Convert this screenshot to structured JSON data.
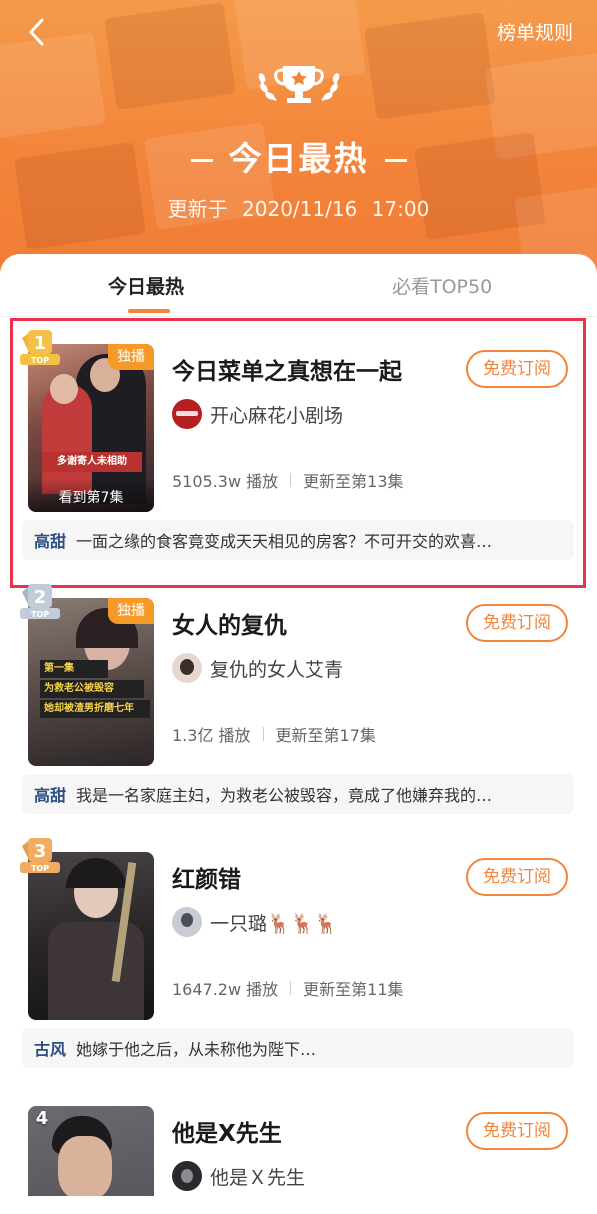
{
  "header": {
    "rules_label": "榜单规则",
    "title": "今日最热",
    "updated_prefix": "更新于",
    "updated_date": "2020/11/16",
    "updated_time": "17:00"
  },
  "tabs": [
    {
      "label": "今日最热",
      "active": true
    },
    {
      "label": "必看TOP50",
      "active": false
    }
  ],
  "colors": {
    "accent": "#f3843a",
    "highlight": "#e8334a",
    "genre": "#2b4f83",
    "exclusive": "#f59a28"
  },
  "items": [
    {
      "rank": "1",
      "rank_label": "TOP",
      "title": "今日菜单之真想在一起",
      "exclusive": "独播",
      "watch_progress": "看到第7集",
      "poster_text": "多谢寄人未相助",
      "author": "开心麻花小剧场",
      "plays": "5105.3w 播放",
      "updated": "更新至第13集",
      "genre": "高甜",
      "description": "一面之缘的食客竟变成天天相见的房客？不可开交的欢喜…",
      "subscribe": "免费订阅"
    },
    {
      "rank": "2",
      "rank_label": "TOP",
      "title": "女人的复仇",
      "exclusive": "独播",
      "poster_text_1": "第一集",
      "poster_text_2": "为救老公被毁容",
      "poster_text_3": "她却被渣男折磨七年",
      "author": "复仇的女人艾青",
      "plays": "1.3亿 播放",
      "updated": "更新至第17集",
      "genre": "高甜",
      "description": "我是一名家庭主妇，为救老公被毁容，竟成了他嫌弃我的…",
      "subscribe": "免费订阅"
    },
    {
      "rank": "3",
      "rank_label": "TOP",
      "title": "红颜错",
      "author": "一只璐🦌🦌🦌",
      "plays": "1647.2w 播放",
      "updated": "更新至第11集",
      "genre": "古风",
      "description": "她嫁于他之后，从未称他为陛下…",
      "subscribe": "免费订阅"
    },
    {
      "rank": "4",
      "title": "他是X先生",
      "author": "他是Ｘ先生",
      "subscribe": "免费订阅"
    }
  ]
}
